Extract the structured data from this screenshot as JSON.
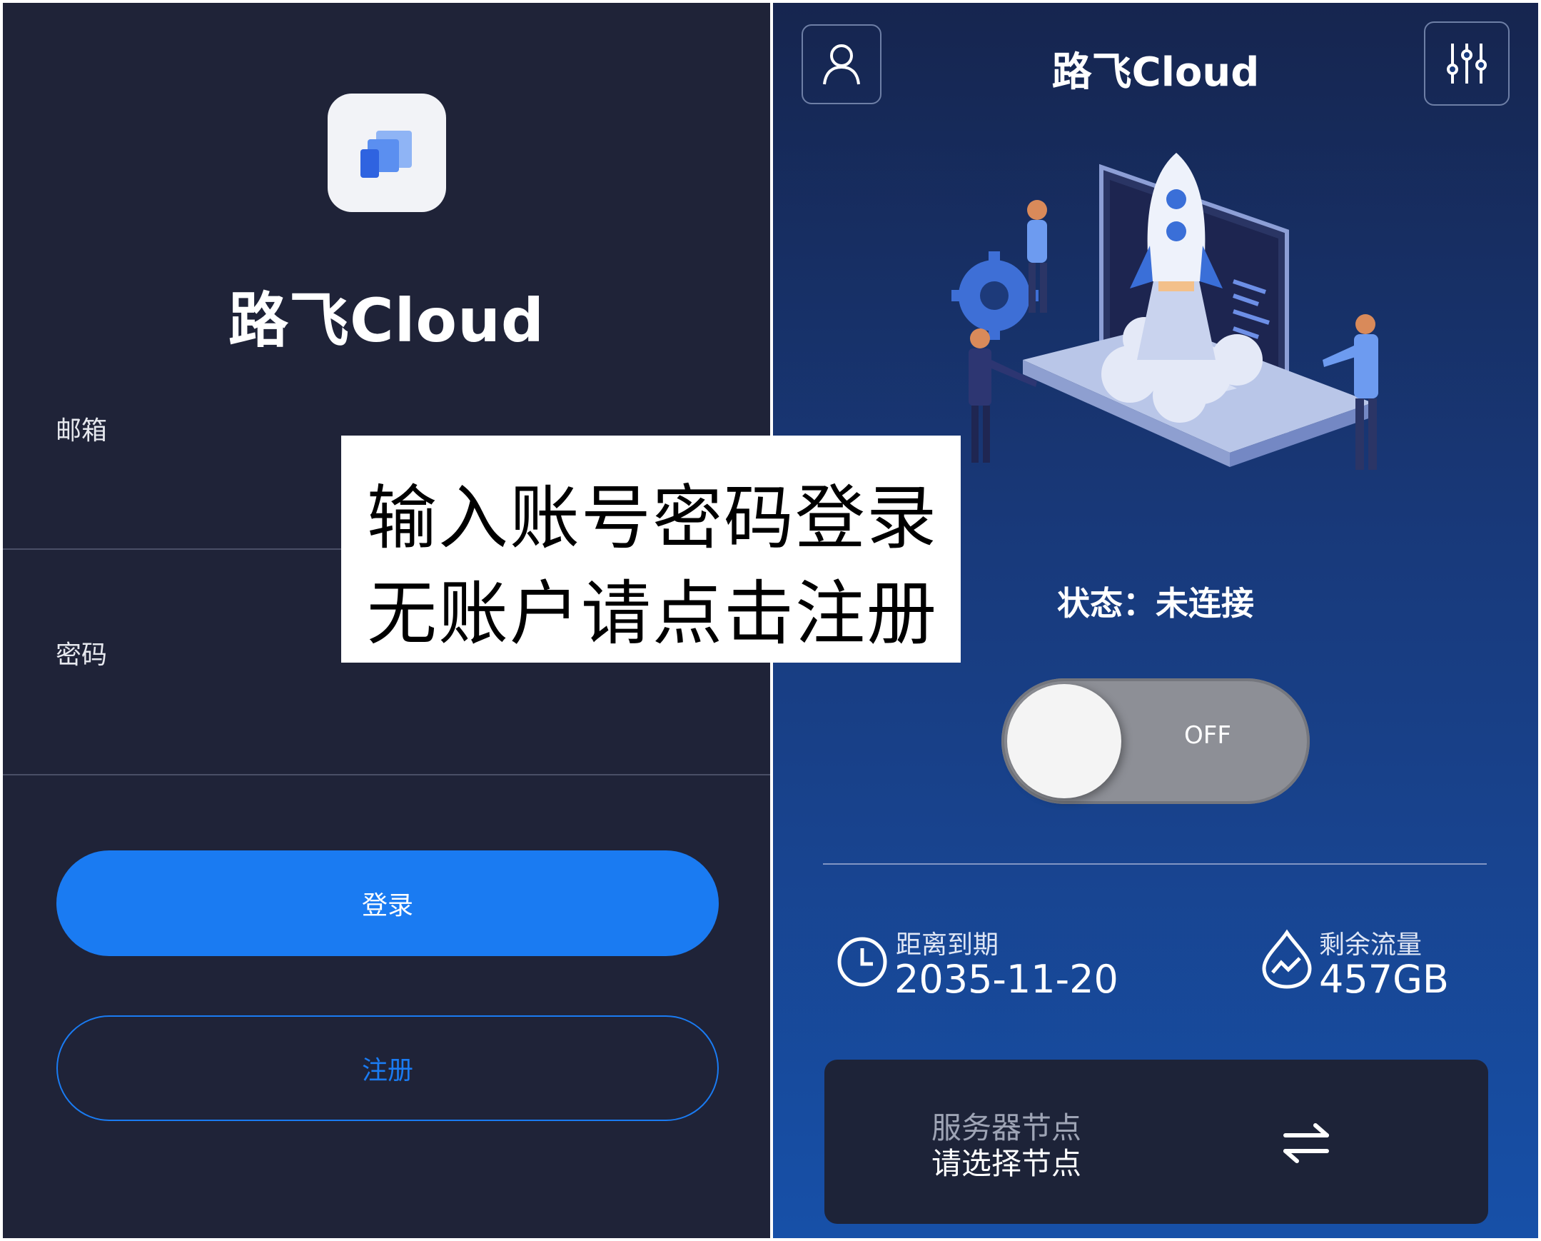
{
  "login": {
    "app_title": "路飞Cloud",
    "email_label": "邮箱",
    "password_label": "密码",
    "login_button": "登录",
    "register_button": "注册",
    "logo_icon": "stacked-windows-icon"
  },
  "dashboard": {
    "title": "路飞Cloud",
    "user_icon": "user-icon",
    "settings_icon": "sliders-icon",
    "status": "状态：未连接",
    "toggle_label": "OFF",
    "expiry": {
      "label": "距离到期",
      "value": "2035-11-20",
      "icon": "clock-icon"
    },
    "traffic": {
      "label": "剩余流量",
      "value": "457GB",
      "icon": "water-drop-chart-icon"
    },
    "server": {
      "title": "服务器节点",
      "value": "请选择节点",
      "icon": "swap-arrows-icon"
    }
  },
  "caption": {
    "line1": "输入账号密码登录",
    "line2": "无账户请点击注册"
  },
  "colors": {
    "accent": "#1a7bf2",
    "left_bg": "#1f2338",
    "right_bg": "#183a7c"
  }
}
